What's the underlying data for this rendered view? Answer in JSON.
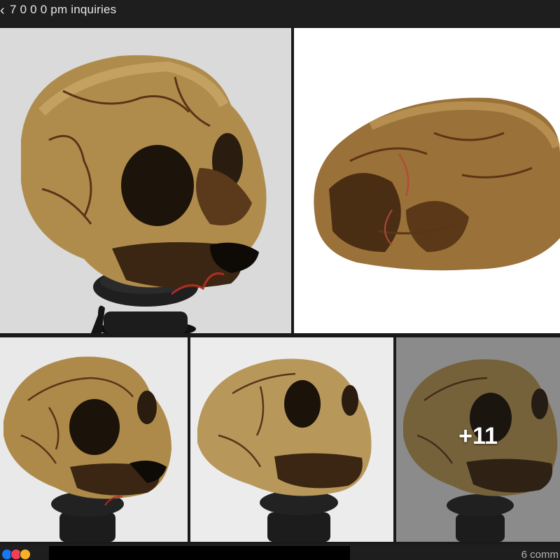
{
  "header": {
    "back_glyph": "‹",
    "post_text": "7  0  0  0   pm inquiries"
  },
  "gallery": {
    "more_count": "+11",
    "photos": [
      {
        "name": "skull-photo-1",
        "background": "#d9dad9"
      },
      {
        "name": "skull-photo-2",
        "background": "#ffffff"
      },
      {
        "name": "skull-photo-3",
        "background": "#e9e9e9"
      },
      {
        "name": "skull-photo-4",
        "background": "#ececec"
      },
      {
        "name": "skull-photo-5",
        "background": "#c6c6c6"
      }
    ]
  },
  "footer": {
    "reactions": [
      "like-icon",
      "love-icon",
      "care-icon"
    ],
    "comments_text": "6 comm"
  },
  "colors": {
    "bone": "#b08c4c",
    "bone_dark": "#6b4a22",
    "stand": "#1b1b1b"
  }
}
